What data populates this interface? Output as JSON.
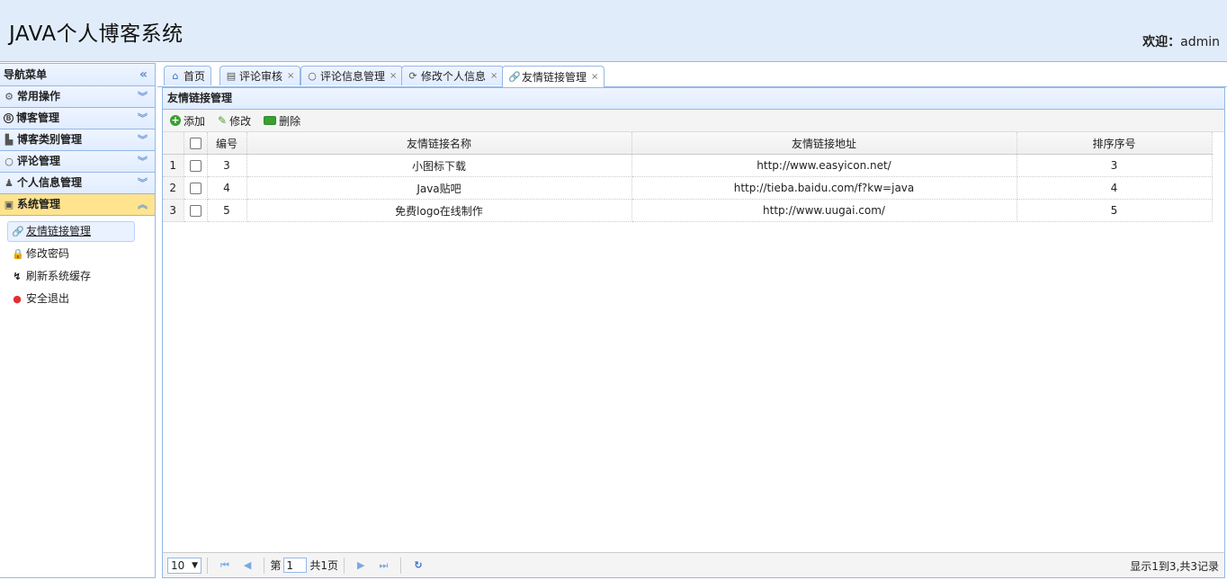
{
  "header": {
    "title": "JAVA个人博客系统",
    "welcome_label": "欢迎：",
    "user": "admin"
  },
  "sidebar": {
    "title": "导航菜单",
    "sections": [
      {
        "label": "常用操作",
        "icon": "gear-icon"
      },
      {
        "label": "博客管理",
        "icon": "blog-icon"
      },
      {
        "label": "博客类别管理",
        "icon": "category-icon"
      },
      {
        "label": "评论管理",
        "icon": "comment-icon"
      },
      {
        "label": "个人信息管理",
        "icon": "user-icon"
      },
      {
        "label": "系统管理",
        "icon": "system-icon"
      }
    ],
    "items": [
      {
        "label": "友情链接管理",
        "icon": "link-icon"
      },
      {
        "label": "修改密码",
        "icon": "key-icon"
      },
      {
        "label": "刷新系统缓存",
        "icon": "refresh-icon"
      },
      {
        "label": "安全退出",
        "icon": "exit-icon"
      }
    ]
  },
  "tabs": [
    {
      "label": "首页",
      "icon": "home-icon"
    },
    {
      "label": "评论审核",
      "icon": "comment-review-icon"
    },
    {
      "label": "评论信息管理",
      "icon": "comment-icon"
    },
    {
      "label": "修改个人信息",
      "icon": "refresh-icon"
    },
    {
      "label": "友情链接管理",
      "icon": "link-icon"
    }
  ],
  "panel": {
    "title": "友情链接管理",
    "toolbar": {
      "add": "添加",
      "edit": "修改",
      "delete": "删除"
    },
    "columns": [
      "编号",
      "友情链接名称",
      "友情链接地址",
      "排序序号"
    ],
    "rows": [
      {
        "rownum": "1",
        "id": "3",
        "name": "小图标下载",
        "url": "http://www.easyicon.net/",
        "order": "3"
      },
      {
        "rownum": "2",
        "id": "4",
        "name": "Java贴吧",
        "url": "http://tieba.baidu.com/f?kw=java",
        "order": "4"
      },
      {
        "rownum": "3",
        "id": "5",
        "name": "免费logo在线制作",
        "url": "http://www.uugai.com/",
        "order": "5"
      }
    ]
  },
  "pager": {
    "page_size": "10",
    "page_prefix": "第",
    "page_value": "1",
    "page_total": "共1页",
    "info": "显示1到3,共3记录"
  }
}
